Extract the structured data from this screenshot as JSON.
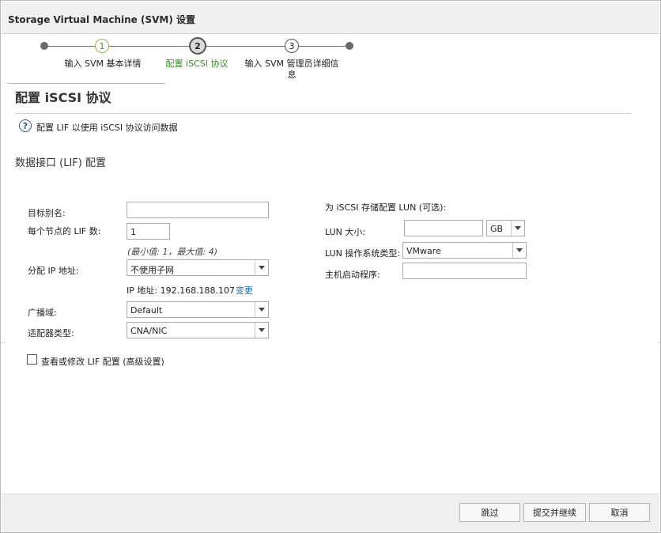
{
  "dialog": {
    "title": "Storage Virtual Machine (SVM) 设置"
  },
  "stepper": {
    "steps": [
      {
        "number": "1",
        "label": "输入 SVM 基本详情"
      },
      {
        "number": "2",
        "label": "配置 iSCSI 协议"
      },
      {
        "number": "3",
        "label_line1": "输入 SVM 管理员详细信",
        "label_line2": "息"
      }
    ]
  },
  "page": {
    "title": "配置 iSCSI 协议",
    "help_text": "配置 LIF 以使用 iSCSI 协议访问数据",
    "section_title": "数据接口 (LIF) 配置"
  },
  "left_form": {
    "target_alias_label": "目标别名:",
    "target_alias_value": "",
    "lif_per_node_label": "每个节点的 LIF 数:",
    "lif_per_node_value": "1",
    "lif_hint": "(最小值: 1，最大值: 4)",
    "assign_ip_label": "分配 IP 地址:",
    "assign_ip_value": "不使用子网",
    "ip_address_text": "IP 地址: 192.168.188.107",
    "change_link": "变更",
    "broadcast_domain_label": "广播域:",
    "broadcast_domain_value": "Default",
    "adapter_type_label": "适配器类型:",
    "adapter_type_value": "CNA/NIC",
    "advanced_checkbox_label": "查看或修改 LIF 配置 (高级设置)",
    "advanced_checked": false
  },
  "right_form": {
    "provision_title": "为 iSCSI 存储配置 LUN (可选):",
    "lun_size_label": "LUN 大小:",
    "lun_size_value": "",
    "lun_size_unit": "GB",
    "lun_os_type_label": "LUN 操作系统类型:",
    "lun_os_type_value": "VMware",
    "host_initiator_label": "主机启动程序:",
    "host_initiator_value": ""
  },
  "footer": {
    "skip_label": "跳过",
    "submit_label": "提交并继续",
    "cancel_label": "取消"
  }
}
